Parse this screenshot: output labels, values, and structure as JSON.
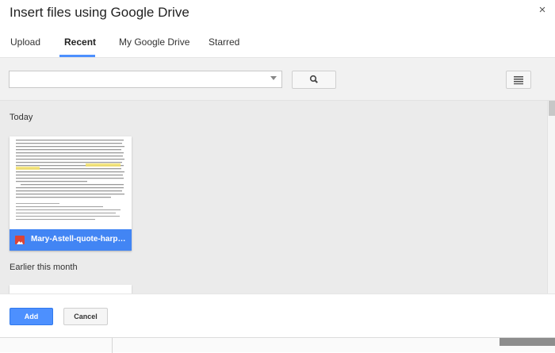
{
  "dialog": {
    "title": "Insert files using Google Drive",
    "close_icon": "close-icon",
    "close_glyph": "×"
  },
  "tabs": [
    {
      "label": "Upload",
      "active": false
    },
    {
      "label": "Recent",
      "active": true
    },
    {
      "label": "My Google Drive",
      "active": false
    },
    {
      "label": "Starred",
      "active": false
    }
  ],
  "toolbar": {
    "search_value": "",
    "search_icon": "search-icon",
    "view_icon": "list-view-icon"
  },
  "sections": [
    {
      "label": "Today",
      "files": [
        {
          "name": "Mary-Astell-quote-harp-b...",
          "type_icon": "image-file-icon",
          "selected": true
        }
      ]
    },
    {
      "label": "Earlier this month",
      "files": []
    }
  ],
  "footer": {
    "add_label": "Add",
    "cancel_label": "Cancel"
  },
  "colors": {
    "accent": "#4d90fe",
    "selected_file": "#4285f4",
    "image_icon": "#db4437",
    "toolbar_bg": "#f1f1f1",
    "content_bg": "#ebebeb"
  }
}
